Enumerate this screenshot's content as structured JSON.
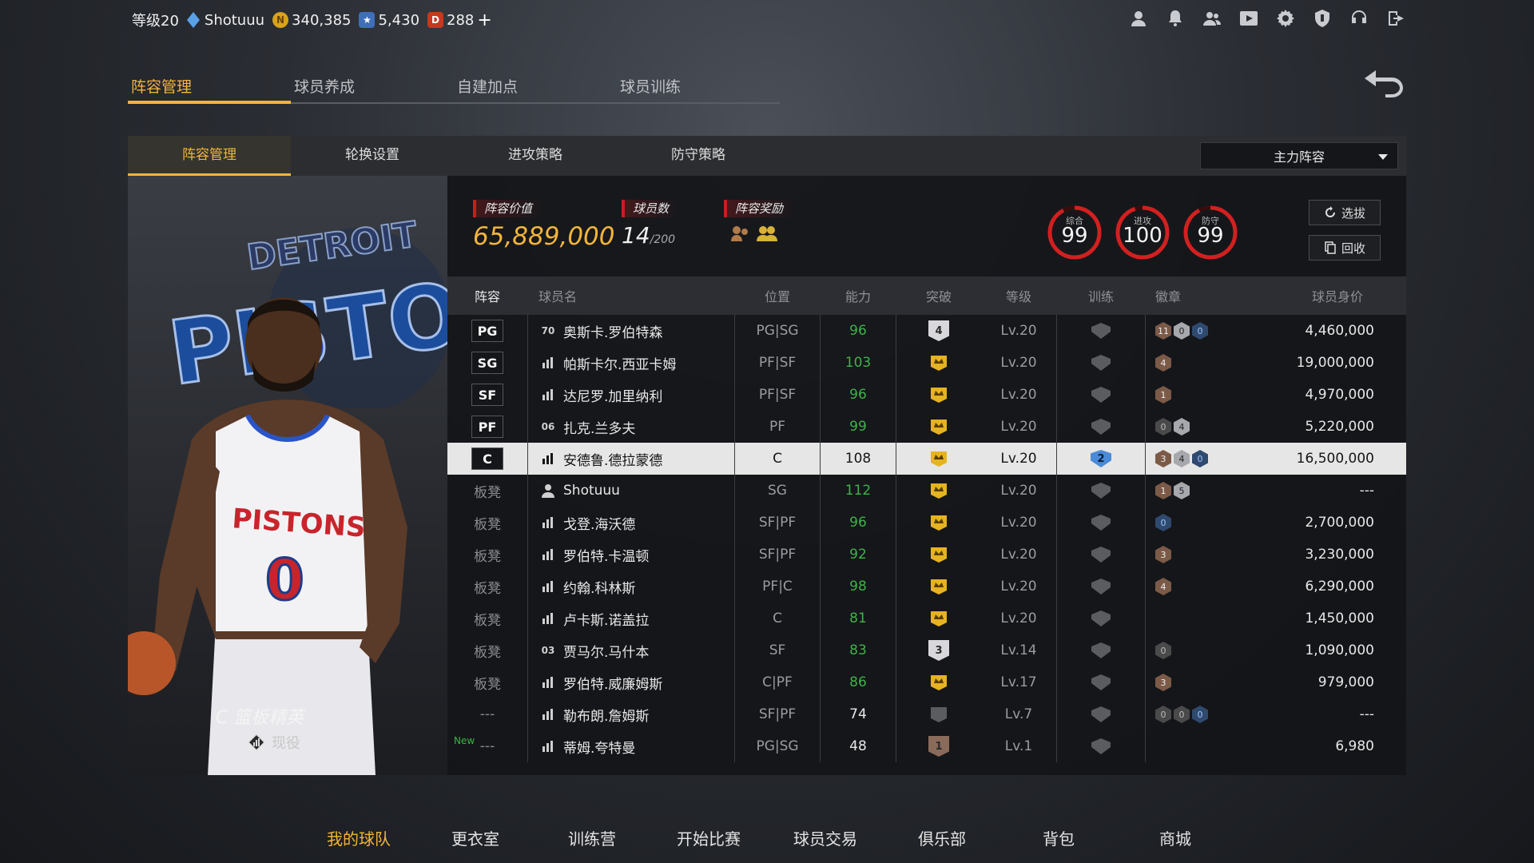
{
  "topbar": {
    "level": "等级20",
    "username": "Shotuuu",
    "coins": "340,385",
    "stars": "5,430",
    "tickets": "288",
    "plus": "+"
  },
  "top_icons": [
    "user-icon",
    "bell-icon",
    "friends-icon",
    "video-icon",
    "gear-icon",
    "shield-icon",
    "headset-icon",
    "exit-icon"
  ],
  "main_tabs": [
    "阵容管理",
    "球员养成",
    "自建加点",
    "球员训练"
  ],
  "sub_tabs": [
    "阵容管理",
    "轮换设置",
    "进攻策略",
    "防守策略"
  ],
  "lineup_select": "主力阵容",
  "card": {
    "team_text": "DETROIT PISTONS",
    "jersey_text": "PISTONS",
    "jersey_number": "0",
    "role": "C 篮板精英",
    "status": "现役"
  },
  "stats": {
    "value_label": "阵容价值",
    "value": "65,889,000",
    "count_label": "球员数",
    "count": "14",
    "count_max": "/200",
    "reward_label": "阵容奖励"
  },
  "ratings": [
    {
      "label": "综合",
      "value": "99"
    },
    {
      "label": "进攻",
      "value": "100"
    },
    {
      "label": "防守",
      "value": "99"
    }
  ],
  "buttons": {
    "select": "选拔",
    "recycle": "回收"
  },
  "headers": [
    "阵容",
    "球员名",
    "位置",
    "能力",
    "突破",
    "等级",
    "训练",
    "徽章",
    "球员身价"
  ],
  "rows": [
    {
      "slot": "PG",
      "tier": "70",
      "name": "奥斯卡.罗伯特森",
      "pos": "PG|SG",
      "ability": "96",
      "ability_color": "green",
      "break": "4",
      "level": "Lv.20",
      "train": "",
      "badges": [
        "11",
        "0",
        "0"
      ],
      "price": "4,460,000",
      "new": ""
    },
    {
      "slot": "SG",
      "tier": "",
      "name": "帕斯卡尔.西亚卡姆",
      "pos": "PF|SF",
      "ability": "103",
      "ability_color": "green",
      "break": "crown",
      "level": "Lv.20",
      "train": "",
      "badges": [
        "4"
      ],
      "price": "19,000,000",
      "new": ""
    },
    {
      "slot": "SF",
      "tier": "",
      "name": "达尼罗.加里纳利",
      "pos": "PF|SF",
      "ability": "96",
      "ability_color": "green",
      "break": "crown",
      "level": "Lv.20",
      "train": "",
      "badges": [
        "1"
      ],
      "price": "4,970,000",
      "new": ""
    },
    {
      "slot": "PF",
      "tier": "06",
      "name": "扎克.兰多夫",
      "pos": "PF",
      "ability": "99",
      "ability_color": "green",
      "break": "crown",
      "level": "Lv.20",
      "train": "",
      "badges": [
        "0",
        "4"
      ],
      "price": "5,220,000",
      "new": ""
    },
    {
      "slot": "C",
      "tier": "",
      "name": "安德鲁.德拉蒙德",
      "pos": "C",
      "ability": "108",
      "ability_color": "white",
      "break": "crown",
      "level": "Lv.20",
      "train": "2",
      "badges": [
        "3",
        "4",
        "0"
      ],
      "price": "16,500,000",
      "new": ""
    },
    {
      "slot": "板凳",
      "tier": "",
      "name": "Shotuuu",
      "pos": "SG",
      "ability": "112",
      "ability_color": "green",
      "break": "crown",
      "level": "Lv.20",
      "train": "",
      "badges": [
        "1",
        "5"
      ],
      "price": "---",
      "new": ""
    },
    {
      "slot": "板凳",
      "tier": "",
      "name": "戈登.海沃德",
      "pos": "SF|PF",
      "ability": "96",
      "ability_color": "green",
      "break": "crown",
      "level": "Lv.20",
      "train": "",
      "badges": [
        "0"
      ],
      "price": "2,700,000",
      "new": ""
    },
    {
      "slot": "板凳",
      "tier": "",
      "name": "罗伯特.卡温顿",
      "pos": "SF|PF",
      "ability": "92",
      "ability_color": "green",
      "break": "crown",
      "level": "Lv.20",
      "train": "",
      "badges": [
        "3"
      ],
      "price": "3,230,000",
      "new": ""
    },
    {
      "slot": "板凳",
      "tier": "",
      "name": "约翰.科林斯",
      "pos": "PF|C",
      "ability": "98",
      "ability_color": "green",
      "break": "crown",
      "level": "Lv.20",
      "train": "",
      "badges": [
        "4"
      ],
      "price": "6,290,000",
      "new": ""
    },
    {
      "slot": "板凳",
      "tier": "",
      "name": "卢卡斯.诺盖拉",
      "pos": "C",
      "ability": "81",
      "ability_color": "green",
      "break": "crown",
      "level": "Lv.20",
      "train": "",
      "badges": [],
      "price": "1,450,000",
      "new": ""
    },
    {
      "slot": "板凳",
      "tier": "03",
      "name": "贾马尔.马什本",
      "pos": "SF",
      "ability": "83",
      "ability_color": "green",
      "break": "3",
      "level": "Lv.14",
      "train": "",
      "badges": [
        "0"
      ],
      "price": "1,090,000",
      "new": ""
    },
    {
      "slot": "板凳",
      "tier": "",
      "name": "罗伯特.威廉姆斯",
      "pos": "C|PF",
      "ability": "86",
      "ability_color": "green",
      "break": "crown",
      "level": "Lv.17",
      "train": "",
      "badges": [
        "3"
      ],
      "price": "979,000",
      "new": ""
    },
    {
      "slot": "---",
      "tier": "",
      "name": "勒布朗.詹姆斯",
      "pos": "SF|PF",
      "ability": "74",
      "ability_color": "white",
      "break": "empty",
      "level": "Lv.7",
      "train": "",
      "badges": [
        "0",
        "0",
        "0"
      ],
      "price": "---",
      "new": ""
    },
    {
      "slot": "---",
      "tier": "",
      "name": "蒂姆.夸特曼",
      "pos": "PG|SG",
      "ability": "48",
      "ability_color": "white",
      "break": "1",
      "level": "Lv.1",
      "train": "",
      "badges": [],
      "price": "6,980",
      "new": "New"
    }
  ],
  "bottom_nav": [
    "我的球队",
    "更衣室",
    "训练营",
    "开始比赛",
    "球员交易",
    "俱乐部",
    "背包",
    "商城"
  ],
  "colors": {
    "accent": "#f2b53a",
    "red": "#c81e1e",
    "green": "#3fb24a"
  }
}
